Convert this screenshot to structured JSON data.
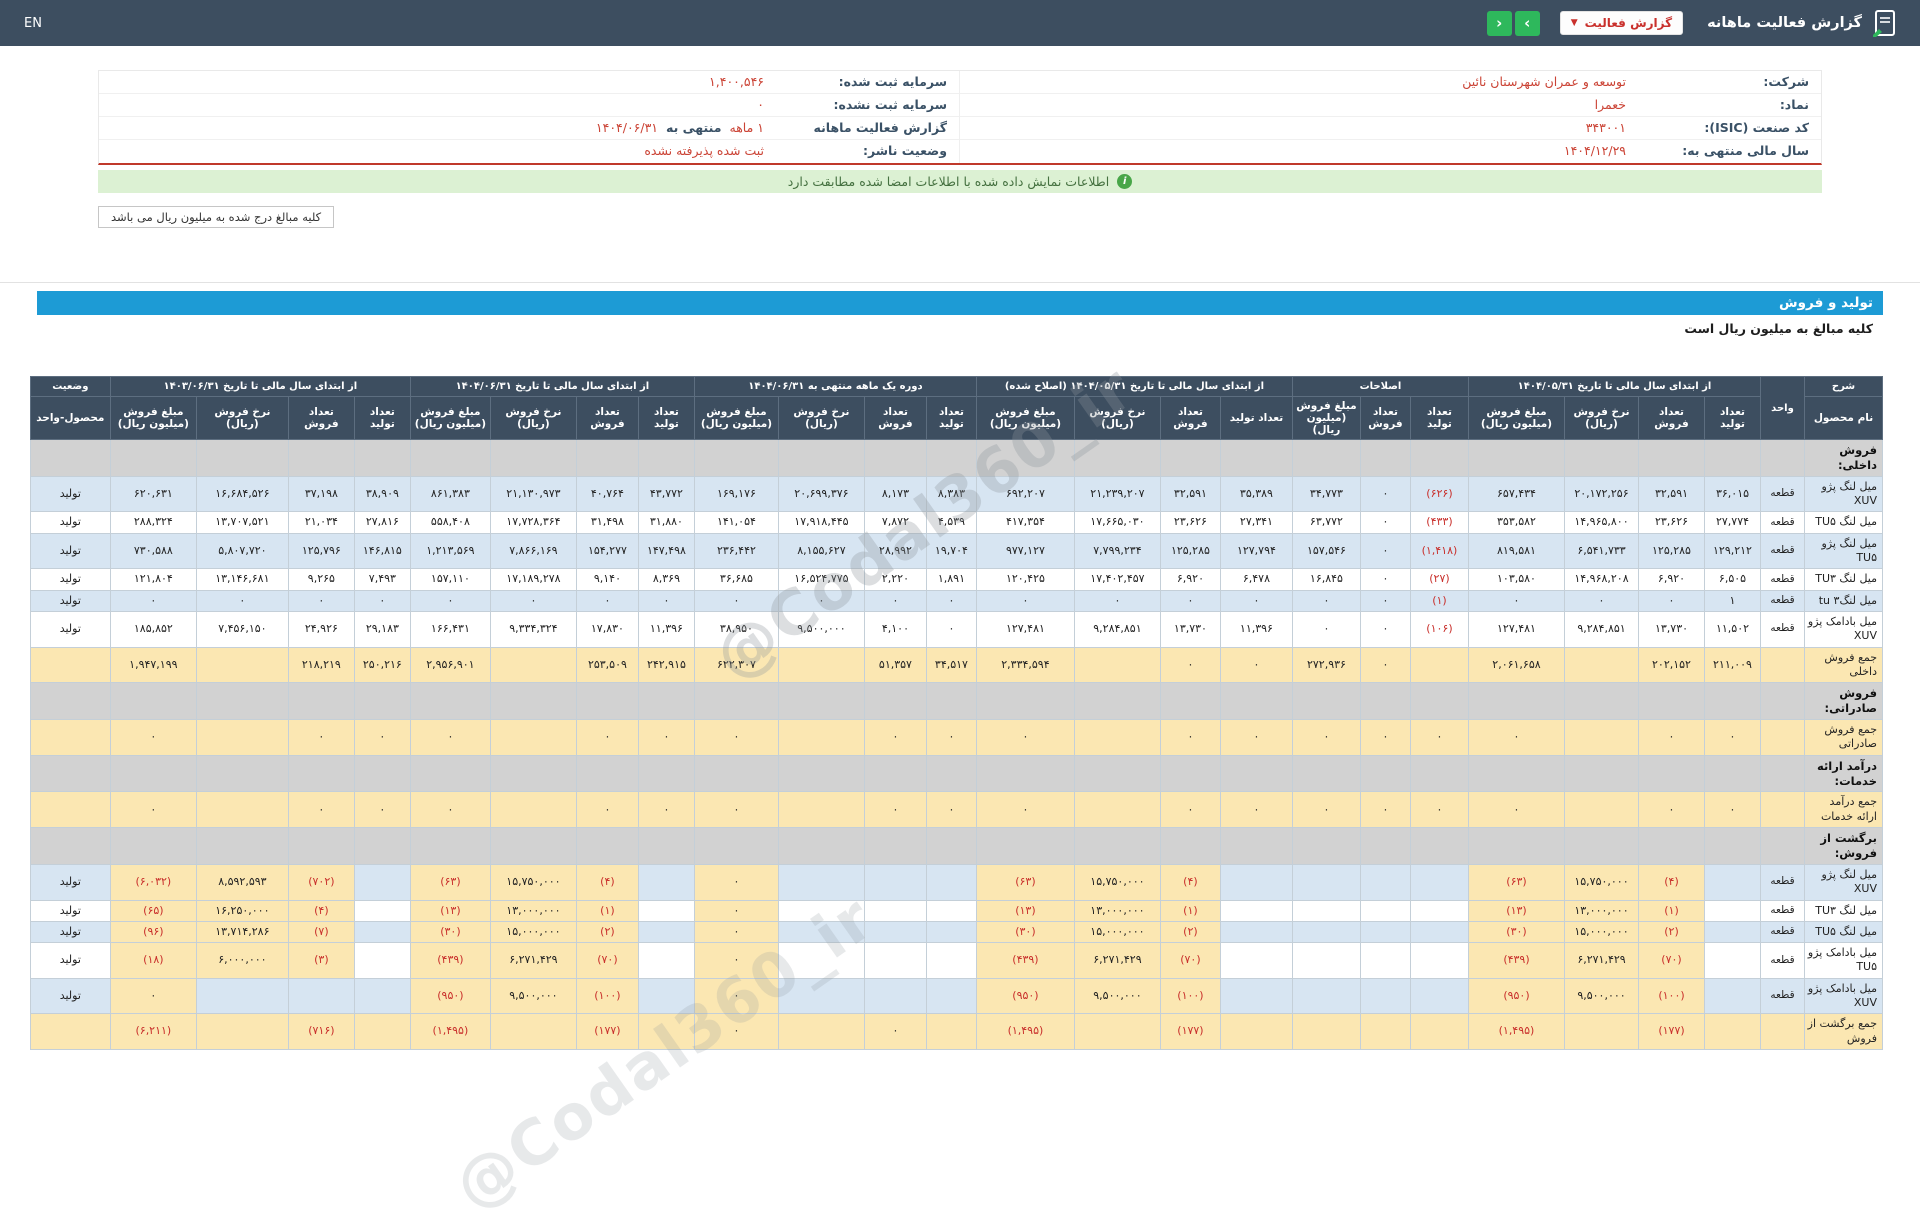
{
  "header_bar": {
    "title": "گزارش فعالیت ماهانه",
    "report_select_label": "گزارش فعالیت",
    "caret_glyph": "▼",
    "arrow_right": "›",
    "arrow_left": "‹",
    "lang_toggle": "EN"
  },
  "company_info": {
    "right_rows": [
      [
        {
          "t": "شرکت:",
          "c": "label"
        },
        {
          "t": "توسعه و عمران شهرستان نائین",
          "c": "value"
        }
      ],
      [
        {
          "t": "نماد:",
          "c": "label"
        },
        {
          "t": "خعمرا",
          "c": "value"
        }
      ],
      [
        {
          "t": "کد صنعت (ISIC):",
          "c": "label"
        },
        {
          "t": "۳۴۳۰۰۱",
          "c": "value"
        }
      ],
      [
        {
          "t": "سال مالی منتهی به:",
          "c": "label"
        },
        {
          "t": "۱۴۰۴/۱۲/۲۹",
          "c": "value"
        }
      ]
    ],
    "left_rows": [
      [
        {
          "t": "سرمایه ثبت شده:",
          "c": "label"
        },
        {
          "t": "۱,۴۰۰,۵۴۶",
          "c": "value"
        }
      ],
      [
        {
          "t": "سرمایه ثبت نشده:",
          "c": "label"
        },
        {
          "t": "۰",
          "c": "value"
        }
      ],
      [
        {
          "t": "گزارش فعالیت ماهانه",
          "c": "label"
        },
        {
          "t": "۱ ماهه",
          "c": "value"
        },
        {
          "t": "منتهی به",
          "c": "label"
        },
        {
          "t": "۱۴۰۴/۰۶/۳۱",
          "c": "value"
        }
      ],
      [
        {
          "t": "وضعیت ناشر:",
          "c": "label"
        },
        {
          "t": "ثبت شده پذیرفته نشده",
          "c": "value"
        }
      ]
    ]
  },
  "notice": {
    "icon_glyph": "i",
    "text": "اطلاعات نمایش داده شده با اطلاعات امضا شده مطابقت دارد"
  },
  "unit_tab": "کلیه مبالغ درج شده به میلیون ریال می باشد",
  "section": {
    "title": "تولید و فروش",
    "subtitle": "کلیه مبالغ به میلیون ریال است"
  },
  "watermark": "@Codal360_ir",
  "colors": {
    "topbar": "#3d4e60",
    "accent_green": "#2eb85c",
    "section_blue": "#1d9bd5",
    "negative_red": "#c9302c",
    "highlight_yellow": "#fbe7b2",
    "zebra_blue": "#d7e5f2",
    "notice_green_bg": "#dcf1d3",
    "info_value_red": "#cb4335"
  },
  "table": {
    "header": {
      "name_group": "شرح",
      "name_sub": "نام محصول",
      "unit": "واحد",
      "status_group": "وضعیت",
      "status_sub": "محصول-واحد",
      "groups": [
        {
          "title": "از ابتدای سال مالی تا تاریخ ۱۴۰۴/۰۵/۳۱",
          "cols": [
            "تعداد تولید",
            "تعداد فروش",
            "نرخ فروش (ریال)",
            "مبلغ فروش (میلیون ریال)"
          ]
        },
        {
          "title": "اصلاحات",
          "cols": [
            "تعداد تولید",
            "تعداد فروش",
            "مبلغ فروش (میلیون ریال)"
          ]
        },
        {
          "title": "از ابتدای سال مالی تا تاریخ ۱۴۰۴/۰۵/۳۱ (اصلاح شده)",
          "cols": [
            "تعداد تولید",
            "تعداد فروش",
            "نرخ فروش (ریال)",
            "مبلغ فروش (میلیون ریال)"
          ]
        },
        {
          "title": "دوره یک ماهه منتهی به ۱۴۰۴/۰۶/۳۱",
          "cols": [
            "تعداد تولید",
            "تعداد فروش",
            "نرخ فروش (ریال)",
            "مبلغ فروش (میلیون ریال)"
          ]
        },
        {
          "title": "از ابتدای سال مالی تا تاریخ ۱۴۰۴/۰۶/۳۱",
          "cols": [
            "تعداد تولید",
            "تعداد فروش",
            "نرخ فروش (ریال)",
            "مبلغ فروش (میلیون ریال)"
          ]
        },
        {
          "title": "از ابتدای سال مالی تا تاریخ ۱۴۰۳/۰۶/۳۱",
          "cols": [
            "تعداد تولید",
            "تعداد فروش",
            "نرخ فروش (ریال)",
            "مبلغ فروش (میلیون ریال)"
          ]
        }
      ]
    },
    "rows": [
      {
        "type": "section",
        "label": "فروش داخلی:"
      },
      {
        "type": "product",
        "zebra": "b",
        "name": "میل لنگ پژو XUV",
        "unit": "قطعه",
        "status": "تولید",
        "cells": [
          "۳۶,۰۱۵",
          "۳۲,۵۹۱",
          "۲۰,۱۷۲,۲۵۶",
          "۶۵۷,۴۳۴",
          "(۶۲۶)",
          "۰",
          "۳۴,۷۷۳",
          "۳۵,۳۸۹",
          "۳۲,۵۹۱",
          "۲۱,۲۳۹,۲۰۷",
          "۶۹۲,۲۰۷",
          "۸,۳۸۳",
          "۸,۱۷۳",
          "۲۰,۶۹۹,۳۷۶",
          "۱۶۹,۱۷۶",
          "۴۳,۷۷۲",
          "۴۰,۷۶۴",
          "۲۱,۱۳۰,۹۷۳",
          "۸۶۱,۳۸۳",
          "۳۸,۹۰۹",
          "۳۷,۱۹۸",
          "۱۶,۶۸۴,۵۲۶",
          "۶۲۰,۶۳۱"
        ]
      },
      {
        "type": "product",
        "zebra": "w",
        "name": "میل لنگ TU۵",
        "unit": "قطعه",
        "status": "تولید",
        "cells": [
          "۲۷,۷۷۴",
          "۲۳,۶۲۶",
          "۱۴,۹۶۵,۸۰۰",
          "۳۵۳,۵۸۲",
          "(۴۳۳)",
          "۰",
          "۶۳,۷۷۲",
          "۲۷,۳۴۱",
          "۲۳,۶۲۶",
          "۱۷,۶۶۵,۰۳۰",
          "۴۱۷,۳۵۴",
          "۴,۵۳۹",
          "۷,۸۷۲",
          "۱۷,۹۱۸,۴۴۵",
          "۱۴۱,۰۵۴",
          "۳۱,۸۸۰",
          "۳۱,۴۹۸",
          "۱۷,۷۲۸,۳۶۴",
          "۵۵۸,۴۰۸",
          "۲۷,۸۱۶",
          "۲۱,۰۳۴",
          "۱۳,۷۰۷,۵۲۱",
          "۲۸۸,۳۲۴"
        ]
      },
      {
        "type": "product",
        "zebra": "b",
        "name": "میل لنگ پژو TU۵",
        "unit": "قطعه",
        "status": "تولید",
        "cells": [
          "۱۲۹,۲۱۲",
          "۱۲۵,۲۸۵",
          "۶,۵۴۱,۷۳۳",
          "۸۱۹,۵۸۱",
          "(۱,۴۱۸)",
          "۰",
          "۱۵۷,۵۴۶",
          "۱۲۷,۷۹۴",
          "۱۲۵,۲۸۵",
          "۷,۷۹۹,۲۳۴",
          "۹۷۷,۱۲۷",
          "۱۹,۷۰۴",
          "۲۸,۹۹۲",
          "۸,۱۵۵,۶۲۷",
          "۲۳۶,۴۴۲",
          "۱۴۷,۴۹۸",
          "۱۵۴,۲۷۷",
          "۷,۸۶۶,۱۶۹",
          "۱,۲۱۳,۵۶۹",
          "۱۴۶,۸۱۵",
          "۱۲۵,۷۹۶",
          "۵,۸۰۷,۷۲۰",
          "۷۳۰,۵۸۸"
        ]
      },
      {
        "type": "product",
        "zebra": "w",
        "name": "میل لنگ TU۳",
        "unit": "قطعه",
        "status": "تولید",
        "cells": [
          "۶,۵۰۵",
          "۶,۹۲۰",
          "۱۴,۹۶۸,۲۰۸",
          "۱۰۳,۵۸۰",
          "(۲۷)",
          "۰",
          "۱۶,۸۴۵",
          "۶,۴۷۸",
          "۶,۹۲۰",
          "۱۷,۴۰۲,۴۵۷",
          "۱۲۰,۴۲۵",
          "۱,۸۹۱",
          "۲,۲۲۰",
          "۱۶,۵۲۴,۷۷۵",
          "۳۶,۶۸۵",
          "۸,۳۶۹",
          "۹,۱۴۰",
          "۱۷,۱۸۹,۲۷۸",
          "۱۵۷,۱۱۰",
          "۷,۴۹۳",
          "۹,۲۶۵",
          "۱۳,۱۴۶,۶۸۱",
          "۱۲۱,۸۰۴"
        ]
      },
      {
        "type": "product",
        "zebra": "b",
        "name": "میل لنگ۳ tu",
        "unit": "قطعه",
        "status": "تولید",
        "cells": [
          "۱",
          "۰",
          "۰",
          "۰",
          "(۱)",
          "۰",
          "۰",
          "۰",
          "۰",
          "۰",
          "۰",
          "۰",
          "۰",
          "۰",
          "۰",
          "۰",
          "۰",
          "۰",
          "۰",
          "۰",
          "۰",
          "۰",
          "۰"
        ]
      },
      {
        "type": "product",
        "zebra": "w",
        "name": "میل بادامک پژو XUV",
        "unit": "قطعه",
        "status": "تولید",
        "cells": [
          "۱۱,۵۰۲",
          "۱۳,۷۳۰",
          "۹,۲۸۴,۸۵۱",
          "۱۲۷,۴۸۱",
          "(۱۰۶)",
          "۰",
          "۰",
          "۱۱,۳۹۶",
          "۱۳,۷۳۰",
          "۹,۲۸۴,۸۵۱",
          "۱۲۷,۴۸۱",
          "۰",
          "۴,۱۰۰",
          "۹,۵۰۰,۰۰۰",
          "۳۸,۹۵۰",
          "۱۱,۳۹۶",
          "۱۷,۸۳۰",
          "۹,۳۳۴,۳۲۴",
          "۱۶۶,۴۳۱",
          "۲۹,۱۸۳",
          "۲۴,۹۲۶",
          "۷,۴۵۶,۱۵۰",
          "۱۸۵,۸۵۲"
        ]
      },
      {
        "type": "total",
        "name": "جمع فروش داخلی",
        "unit": "",
        "status": "",
        "cells": [
          "۲۱۱,۰۰۹",
          "۲۰۲,۱۵۲",
          "",
          "۲,۰۶۱,۶۵۸",
          "",
          "۰",
          "۲۷۲,۹۳۶",
          "۰",
          "۰",
          "",
          "۲,۳۳۴,۵۹۴",
          "۳۴,۵۱۷",
          "۵۱,۳۵۷",
          "",
          "۶۲۲,۳۰۷",
          "۲۴۲,۹۱۵",
          "۲۵۳,۵۰۹",
          "",
          "۲,۹۵۶,۹۰۱",
          "۲۵۰,۲۱۶",
          "۲۱۸,۲۱۹",
          "",
          "۱,۹۴۷,۱۹۹"
        ]
      },
      {
        "type": "section",
        "label": "فروش صادراتی:"
      },
      {
        "type": "total",
        "name": "جمع فروش صادراتی",
        "unit": "",
        "status": "",
        "cells": [
          "۰",
          "۰",
          "",
          "۰",
          "۰",
          "۰",
          "۰",
          "۰",
          "۰",
          "",
          "۰",
          "۰",
          "۰",
          "",
          "۰",
          "۰",
          "۰",
          "",
          "۰",
          "۰",
          "۰",
          "",
          "۰"
        ]
      },
      {
        "type": "section",
        "label": "درآمد ارائه خدمات:"
      },
      {
        "type": "total",
        "name": "جمع درآمد ارائه خدمات",
        "unit": "",
        "status": "",
        "cells": [
          "۰",
          "۰",
          "",
          "۰",
          "۰",
          "۰",
          "۰",
          "۰",
          "۰",
          "",
          "۰",
          "۰",
          "۰",
          "",
          "۰",
          "۰",
          "۰",
          "",
          "۰",
          "۰",
          "۰",
          "",
          "۰"
        ]
      },
      {
        "type": "section",
        "label": "برگشت از فروش:"
      },
      {
        "type": "product",
        "hl": true,
        "zebra": "b",
        "name": "میل لنگ پژو XUV",
        "unit": "قطعه",
        "status": "تولید",
        "cells": [
          "",
          "(۴)",
          "۱۵,۷۵۰,۰۰۰",
          "(۶۳)",
          "",
          "",
          "",
          "",
          "(۴)",
          "۱۵,۷۵۰,۰۰۰",
          "(۶۳)",
          "",
          "",
          "",
          "۰",
          "",
          "(۴)",
          "۱۵,۷۵۰,۰۰۰",
          "(۶۳)",
          "",
          "(۷۰۲)",
          "۸,۵۹۲,۵۹۳",
          "(۶,۰۳۲)"
        ]
      },
      {
        "type": "product",
        "hl": true,
        "zebra": "w",
        "name": "میل لنگ TU۳",
        "unit": "قطعه",
        "status": "تولید",
        "cells": [
          "",
          "(۱)",
          "۱۳,۰۰۰,۰۰۰",
          "(۱۳)",
          "",
          "",
          "",
          "",
          "(۱)",
          "۱۳,۰۰۰,۰۰۰",
          "(۱۳)",
          "",
          "",
          "",
          "۰",
          "",
          "(۱)",
          "۱۳,۰۰۰,۰۰۰",
          "(۱۳)",
          "",
          "(۴)",
          "۱۶,۲۵۰,۰۰۰",
          "(۶۵)"
        ]
      },
      {
        "type": "product",
        "hl": true,
        "zebra": "b",
        "name": "میل لنگ TU۵",
        "unit": "قطعه",
        "status": "تولید",
        "cells": [
          "",
          "(۲)",
          "۱۵,۰۰۰,۰۰۰",
          "(۳۰)",
          "",
          "",
          "",
          "",
          "(۲)",
          "۱۵,۰۰۰,۰۰۰",
          "(۳۰)",
          "",
          "",
          "",
          "۰",
          "",
          "(۲)",
          "۱۵,۰۰۰,۰۰۰",
          "(۳۰)",
          "",
          "(۷)",
          "۱۳,۷۱۴,۲۸۶",
          "(۹۶)"
        ]
      },
      {
        "type": "product",
        "hl": true,
        "zebra": "w",
        "name": "میل بادامک پژو TU۵",
        "unit": "قطعه",
        "status": "تولید",
        "cells": [
          "",
          "(۷۰)",
          "۶,۲۷۱,۴۲۹",
          "(۴۳۹)",
          "",
          "",
          "",
          "",
          "(۷۰)",
          "۶,۲۷۱,۴۲۹",
          "(۴۳۹)",
          "",
          "",
          "",
          "۰",
          "",
          "(۷۰)",
          "۶,۲۷۱,۴۲۹",
          "(۴۳۹)",
          "",
          "(۳)",
          "۶,۰۰۰,۰۰۰",
          "(۱۸)"
        ]
      },
      {
        "type": "product",
        "hl": true,
        "zebra": "b",
        "name": "میل بادامک پژو XUV",
        "unit": "قطعه",
        "status": "تولید",
        "cells": [
          "",
          "(۱۰۰)",
          "۹,۵۰۰,۰۰۰",
          "(۹۵۰)",
          "",
          "",
          "",
          "",
          "(۱۰۰)",
          "۹,۵۰۰,۰۰۰",
          "(۹۵۰)",
          "",
          "",
          "",
          "۰",
          "",
          "(۱۰۰)",
          "۹,۵۰۰,۰۰۰",
          "(۹۵۰)",
          "",
          "",
          "",
          "۰"
        ]
      },
      {
        "type": "total",
        "name": "جمع برگشت از فروش",
        "unit": "",
        "status": "",
        "cells": [
          "",
          "(۱۷۷)",
          "",
          "(۱,۴۹۵)",
          "",
          "",
          "",
          "",
          "(۱۷۷)",
          "",
          "(۱,۴۹۵)",
          "",
          "۰",
          "",
          "۰",
          "",
          "(۱۷۷)",
          "",
          "(۱,۴۹۵)",
          "",
          "(۷۱۶)",
          "",
          "(۶,۲۱۱)"
        ]
      }
    ]
  }
}
